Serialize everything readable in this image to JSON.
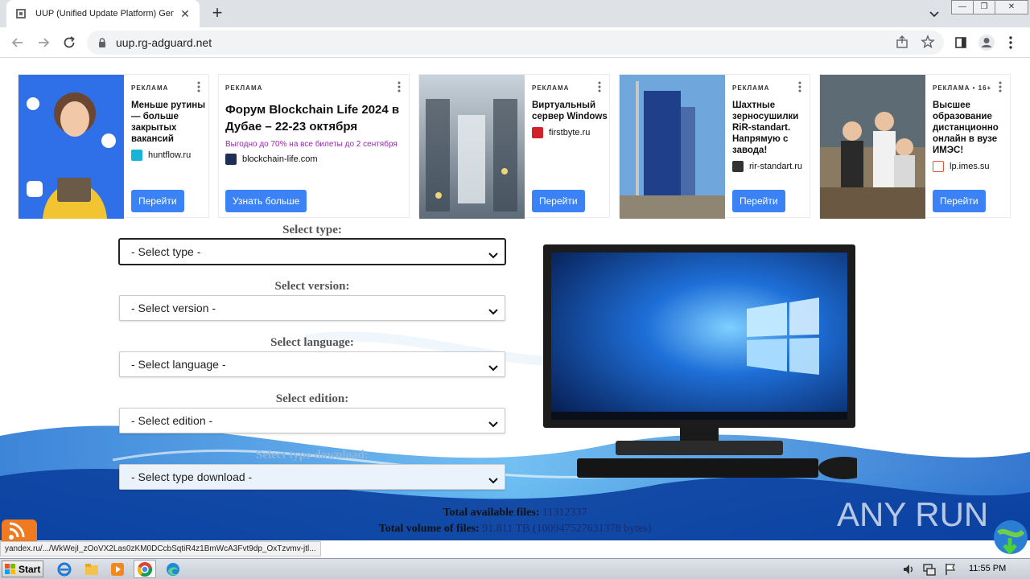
{
  "browser": {
    "tab_title": "UUP (Unified Update Platform) Gene",
    "url": "uup.rg-adguard.net"
  },
  "ads": [
    {
      "label": "РЕКЛАМА",
      "title": "Меньше рутины — больше закрытых вакансий",
      "domain": "huntflow.ru",
      "button": "Перейти"
    },
    {
      "label": "РЕКЛАМА",
      "title": "Форум Blockchain Life 2024 в Дубае – 22-23 октября",
      "promo": "Выгодно до 70% на все билеты до 2 сентября",
      "domain": "blockchain-life.com",
      "button": "Узнать больше"
    },
    {
      "label": "РЕКЛАМА",
      "title": "Виртуальный сервер Windows",
      "domain": "firstbyte.ru",
      "button": "Перейти"
    },
    {
      "label": "РЕКЛАМА",
      "title": "Шахтные зерносушилки RiR-standart. Напрямую с завода!",
      "domain": "rir-standart.ru",
      "button": "Перейти"
    },
    {
      "label": "РЕКЛАМА • 16+",
      "title": "Высшее образование дистанционно онлайн в вузе ИМЭС!",
      "domain": "lp.imes.su",
      "button": "Перейти"
    }
  ],
  "form": {
    "type_label": "Select type:",
    "type_value": "- Select type -",
    "version_label": "Select version:",
    "version_value": "- Select version -",
    "language_label": "Select language:",
    "language_value": "- Select language -",
    "edition_label": "Select edition:",
    "edition_value": "- Select edition -",
    "download_label": "Select type download:",
    "download_value": "- Select type download -"
  },
  "stats": {
    "files_label": "Total available files:",
    "files_value": "11312337",
    "volume_label": "Total volume of files:",
    "volume_value": "91.811 TB (100947527631378 bytes)"
  },
  "status_url": "yandex.ru/.../WkWejI_zOoVX2Las0zKM0DCcbSqtiR4z1BmWcA3Fvt9dp_OxTzvmv-jtl...",
  "watermark": "ANY RUN",
  "taskbar": {
    "start": "Start",
    "time": "11:55 PM"
  },
  "icons": {
    "accent": "#3b82f6",
    "promo_color": "#9c27b0"
  }
}
